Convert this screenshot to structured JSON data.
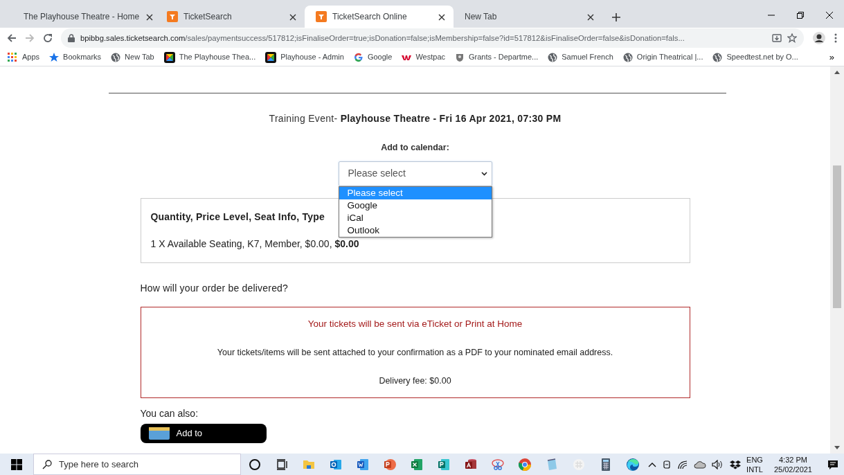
{
  "tabs": [
    {
      "title": "The Playhouse Theatre - Home",
      "selected": false
    },
    {
      "title": "TicketSearch",
      "selected": false
    },
    {
      "title": "TicketSearch Online",
      "selected": true
    },
    {
      "title": "New Tab",
      "selected": false
    }
  ],
  "address_bar": {
    "host": "bpibbg.sales.ticketsearch.com",
    "path": "/sales/paymentsuccess/517812;isFinaliseOrder=true;isDonation=false;isMembership=false?id=517812&isFinaliseOrder=false&isDonation=fals..."
  },
  "bookmarks": [
    {
      "label": "Apps"
    },
    {
      "label": "Bookmarks"
    },
    {
      "label": "New Tab"
    },
    {
      "label": "The Playhouse Thea..."
    },
    {
      "label": "Playhouse - Admin"
    },
    {
      "label": "Google"
    },
    {
      "label": "Westpac"
    },
    {
      "label": "Grants - Departme..."
    },
    {
      "label": "Samuel French"
    },
    {
      "label": "Origin Theatrical |..."
    },
    {
      "label": "Speedtest.net by O..."
    }
  ],
  "bookmarks_overflow": "»",
  "page": {
    "event": "Training Event- **Playhouse Theatre - Fri 16 Apr 2021, 07:30 PM**",
    "calendar": {
      "label": "Add to calendar:",
      "value": "Please select",
      "open": true,
      "options": [
        {
          "label": "Please select",
          "selected": true
        },
        {
          "label": "Google",
          "selected": false
        },
        {
          "label": "iCal",
          "selected": false
        },
        {
          "label": "Outlook",
          "selected": false
        }
      ]
    },
    "order": {
      "heading": "Quantity, Price Level, Seat Info, Type",
      "line": "1 X Available Seating, K7, Member, $0.00, **$0.00**"
    },
    "delivery": {
      "question": "How will your order be delivered?",
      "title": "Your tickets will be sent via eTicket or Print at Home",
      "body": "Your tickets/items will be sent attached to your confirmation as a PDF to your nominated email address.",
      "fee": "Delivery fee: $0.00"
    },
    "also": {
      "label": "You can also:",
      "button": "Add to"
    }
  },
  "taskbar": {
    "search_placeholder": "Type here to search",
    "apps": [
      {
        "kind": "cortana"
      },
      {
        "kind": "taskview"
      },
      {
        "kind": "folder"
      },
      {
        "kind": "mail"
      },
      {
        "kind": "word"
      },
      {
        "kind": "slides"
      },
      {
        "kind": "sheet"
      },
      {
        "kind": "publisher"
      },
      {
        "kind": "database"
      },
      {
        "kind": "snip"
      },
      {
        "kind": "chrome"
      },
      {
        "kind": "notepad"
      },
      {
        "kind": "chat"
      },
      {
        "kind": "calculator"
      },
      {
        "kind": "edge"
      }
    ],
    "language": "ENG",
    "layout": "INTL",
    "time": "4:32 PM",
    "date": "25/02/2021"
  }
}
